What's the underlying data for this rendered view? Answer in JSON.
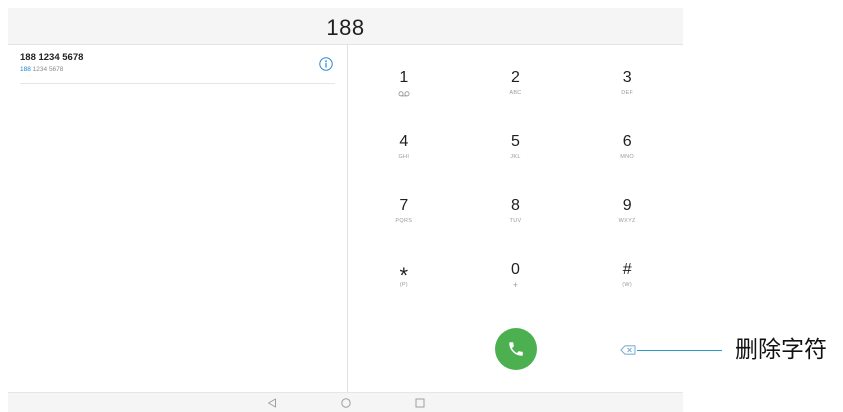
{
  "dialer": {
    "input_number": "188",
    "suggestion": {
      "number": "188 1234 5678",
      "detail_match": "188",
      "detail_rest": "1234 5678",
      "info_icon": "info-icon"
    },
    "keypad": [
      {
        "digit": "1",
        "letters_icon": "voicemail-icon"
      },
      {
        "digit": "2",
        "letters": "ABC"
      },
      {
        "digit": "3",
        "letters": "DEF"
      },
      {
        "digit": "4",
        "letters": "GHI"
      },
      {
        "digit": "5",
        "letters": "JKL"
      },
      {
        "digit": "6",
        "letters": "MNO"
      },
      {
        "digit": "7",
        "letters": "PQRS"
      },
      {
        "digit": "8",
        "letters": "TUV"
      },
      {
        "digit": "9",
        "letters": "WXYZ"
      },
      {
        "digit": "*",
        "letters": "(P)"
      },
      {
        "digit": "0",
        "letters": "+"
      },
      {
        "digit": "#",
        "letters": "(W)"
      }
    ],
    "call_button_icon": "phone-icon",
    "backspace_icon": "backspace-icon"
  },
  "nav_bar": {
    "back_icon": "back-icon",
    "home_icon": "home-icon",
    "recents_icon": "recents-icon"
  },
  "annotation": {
    "label": "删除字符"
  },
  "colors": {
    "accent_blue": "#1e86d6",
    "call_green": "#4caf50",
    "annotation_line": "#2b9ac4",
    "bar_background": "#f5f5f5"
  }
}
